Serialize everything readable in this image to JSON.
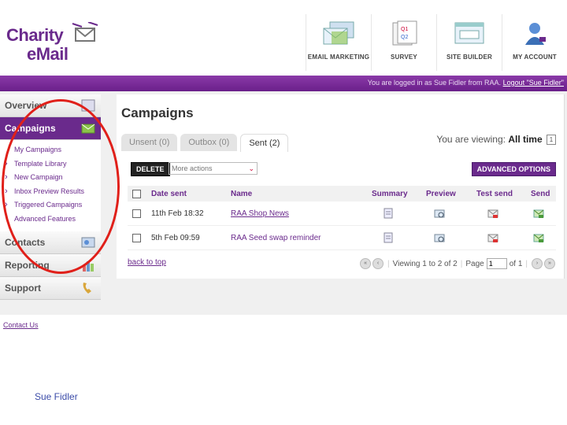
{
  "logo": {
    "line1": "Charity",
    "line2": "eMail"
  },
  "topnav": [
    {
      "label": "EMAIL MARKETING",
      "icon": "envelopes-icon"
    },
    {
      "label": "SURVEY",
      "icon": "survey-icon"
    },
    {
      "label": "SITE BUILDER",
      "icon": "site-builder-icon"
    },
    {
      "label": "MY ACCOUNT",
      "icon": "user-icon"
    }
  ],
  "login": {
    "text": "You are logged in as Sue Fidler from RAA.",
    "logout": "Logout \"Sue Fidler\""
  },
  "sidebar": {
    "overview": "Overview",
    "campaigns": "Campaigns",
    "sub": [
      "My Campaigns",
      "Template Library",
      "New Campaign",
      "Inbox Preview Results",
      "Triggered Campaigns",
      "Advanced Features"
    ],
    "contacts": "Contacts",
    "reporting": "Reporting",
    "support": "Support"
  },
  "main": {
    "title": "Campaigns",
    "tabs": [
      "Unsent (0)",
      "Outbox (0)",
      "Sent (2)"
    ],
    "viewing_label": "You are viewing:",
    "viewing_value": "All time",
    "viewing_btn": "1",
    "delete": "DELETE",
    "more_actions": "More actions",
    "advanced": "ADVANCED OPTIONS",
    "columns": [
      "Date sent",
      "Name",
      "Summary",
      "Preview",
      "Test send",
      "Send"
    ],
    "rows": [
      {
        "date": "11th Feb 18:32",
        "name": "RAA Shop News"
      },
      {
        "date": "5th Feb 09:59",
        "name": "RAA Seed swap reminder"
      }
    ],
    "back_to_top": "back to top",
    "viewing_count": "Viewing 1 to 2 of 2",
    "page_label": "Page",
    "page_value": "1",
    "of_label": "of 1"
  },
  "footer": {
    "contact": "Contact Us",
    "name": "Sue Fidler"
  },
  "colors": {
    "brand": "#6a2a8c",
    "annotation": "#e0201a"
  }
}
